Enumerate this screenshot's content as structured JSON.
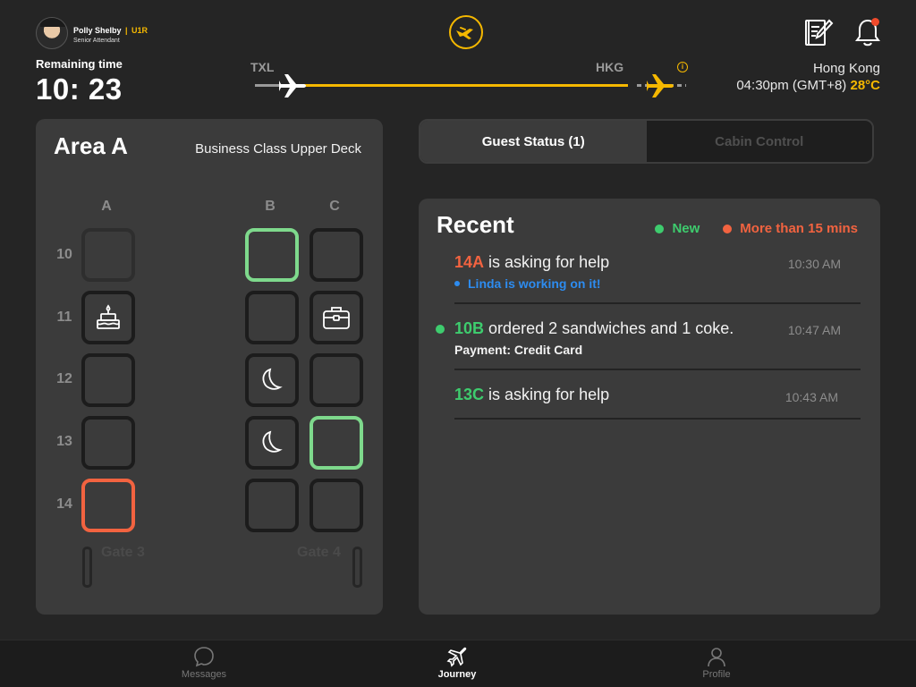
{
  "user": {
    "name": "Polly Shelby",
    "separator": "|",
    "code": "U1R",
    "role": "Senior Attendant"
  },
  "remaining": {
    "label": "Remaining time",
    "value": "10: 23"
  },
  "route": {
    "from": "TXL",
    "to": "HKG",
    "progress_fraction": 0.85
  },
  "destination": {
    "city": "Hong Kong",
    "time": "04:30pm (GMT+8)",
    "temperature": "28°C"
  },
  "area": {
    "title": "Area A",
    "subtitle": "Business Class Upper Deck",
    "columns": [
      "A",
      "B",
      "C"
    ],
    "rows": [
      "10",
      "11",
      "12",
      "13",
      "14"
    ],
    "gates": [
      "Gate 3",
      "Gate 4"
    ]
  },
  "tabs": {
    "guest_status": "Guest Status (1)",
    "cabin_control": "Cabin Control"
  },
  "recent": {
    "title": "Recent",
    "legend_new": "New",
    "legend_late": "More than 15 mins",
    "items": [
      {
        "seat": "14A",
        "text": "is asking for help",
        "time": "10:30 AM",
        "sub": "Linda is working on it!"
      },
      {
        "seat": "10B",
        "text": "ordered 2 sandwiches and 1 coke.",
        "time": "10:47 AM",
        "sub": "Payment: Credit Card"
      },
      {
        "seat": "13C",
        "text": "is asking for help",
        "time": "10:43 AM"
      }
    ]
  },
  "nav": {
    "messages": "Messages",
    "journey": "Journey",
    "profile": "Profile"
  },
  "colors": {
    "accent": "#f5b800",
    "new": "#3ecc6e",
    "late": "#f26340",
    "info": "#2d8cf0"
  }
}
